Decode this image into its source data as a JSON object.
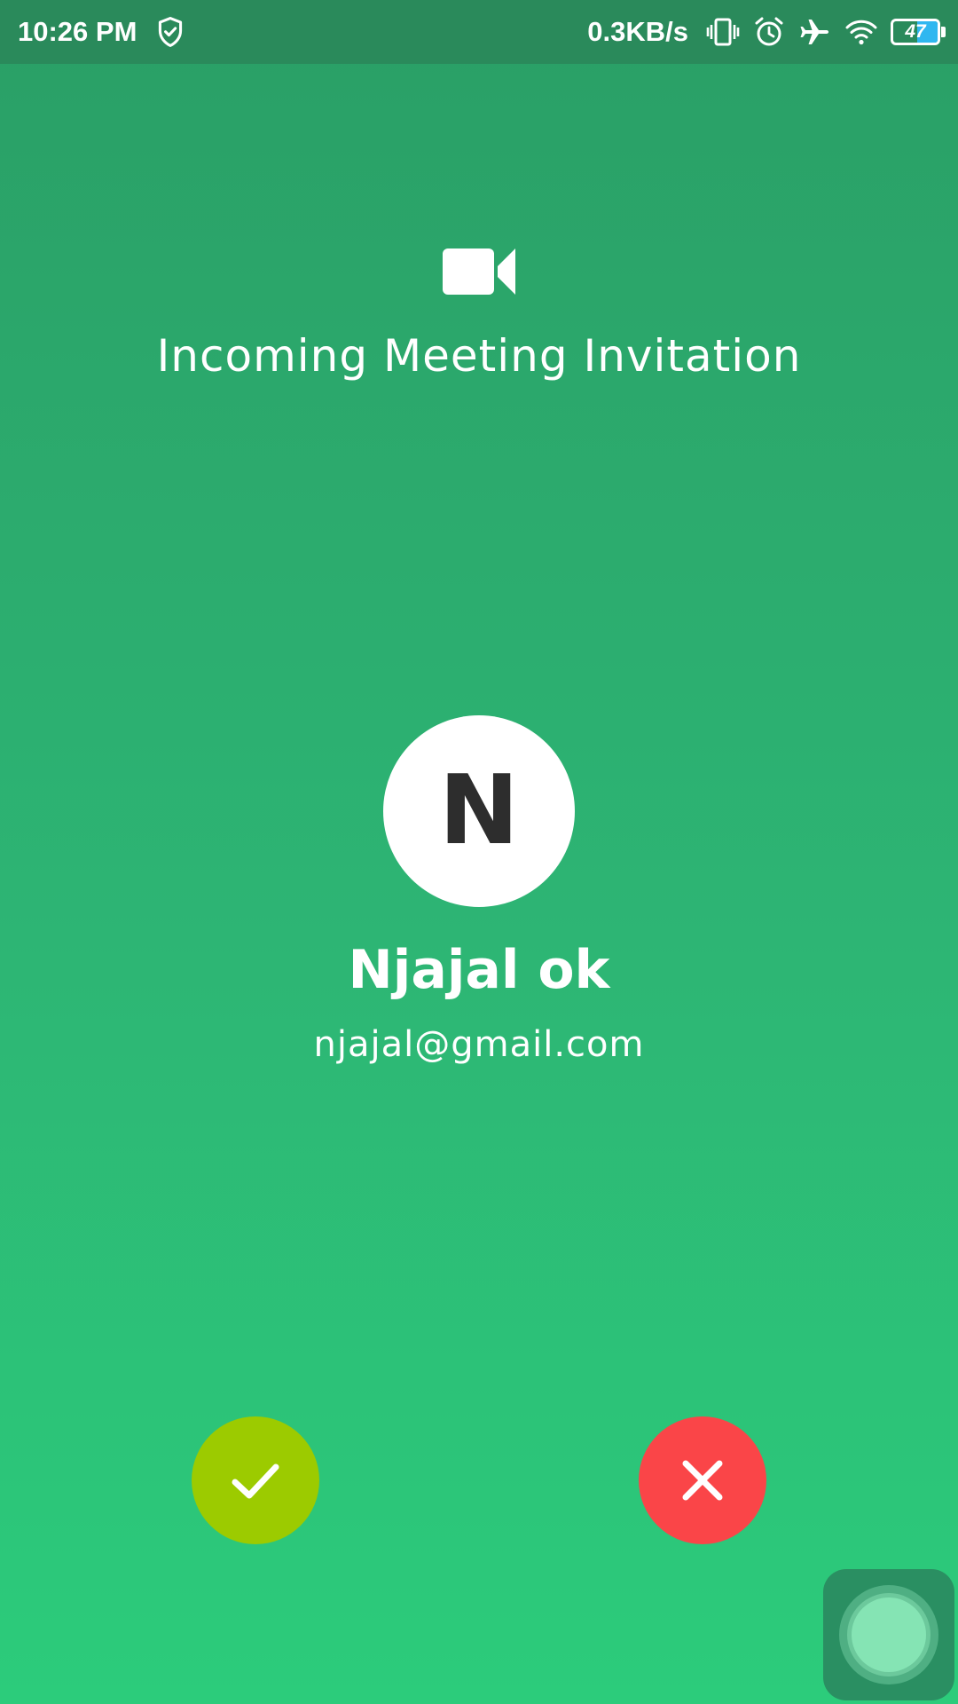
{
  "status_bar": {
    "time": "10:26 PM",
    "network_speed": "0.3KB/s",
    "battery_level": "47",
    "battery_fraction": 0.47,
    "icons": [
      "shield-check-icon",
      "vibrate-icon",
      "alarm-icon",
      "airplane-mode-icon",
      "wifi-icon",
      "battery-icon"
    ]
  },
  "invitation": {
    "icon": "video-camera-icon",
    "title": "Incoming Meeting Invitation"
  },
  "caller": {
    "initial": "N",
    "name": "Njajal ok",
    "email": "njajal@gmail.com"
  },
  "actions": {
    "accept_icon": "checkmark-icon",
    "decline_icon": "close-icon"
  },
  "colors": {
    "background_top": "#2a9f66",
    "background_bottom": "#2ccc7b",
    "status_bar": "#2a8a5b",
    "accept": "#9ccb00",
    "decline": "#fa4548",
    "battery_fill": "#2fb7f0",
    "avatar_text": "#2d2d2d"
  }
}
